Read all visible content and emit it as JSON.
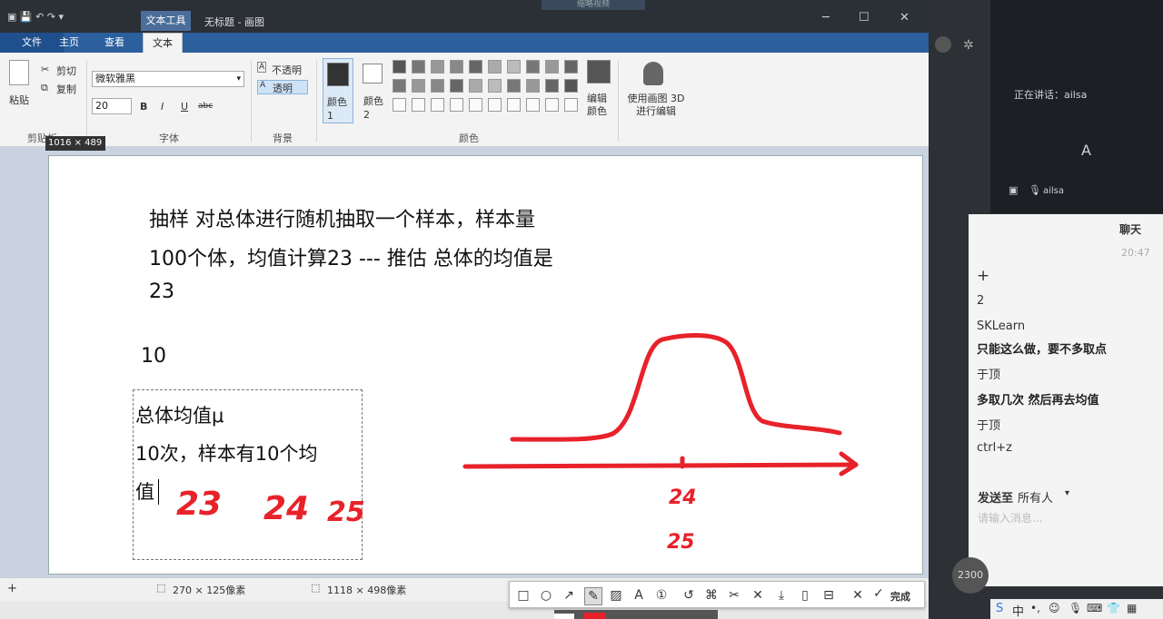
{
  "window": {
    "title": "无标题 - 画图",
    "context_tab": "文本工具",
    "top_hint": "缩略视频"
  },
  "tabs": [
    "文件",
    "主页",
    "查看",
    "文本"
  ],
  "ribbon": {
    "clipboard": {
      "paste": "粘贴",
      "cut": "剪切",
      "copy": "复制",
      "group": "剪贴板"
    },
    "font": {
      "family": "微软雅黑",
      "size": "20",
      "bold": "B",
      "italic": "I",
      "underline": "U",
      "strike": "abc",
      "group": "字体"
    },
    "background": {
      "opaque": "不透明",
      "transparent": "透明",
      "group": "背景"
    },
    "colors": {
      "color1": "颜色 1",
      "color2": "颜色 2",
      "edit_colors": "编辑颜色",
      "group": "颜色",
      "color1_value": "#333333",
      "color2_value": "#ffffff"
    },
    "paint3d": "使用画图 3D 进行编辑"
  },
  "canvas": {
    "size_tooltip": "1016 × 489",
    "lines": [
      "抽样  对总体进行随机抽取一个样本，样本量",
      "100个体，均值计算23 --- 推估 总体的均值是",
      "23"
    ],
    "number": "10",
    "textbox_lines": [
      "总体均值μ",
      "10次，样本有10个均",
      "值"
    ],
    "handwriting": [
      "23",
      "24",
      "25",
      "24",
      "25"
    ],
    "ink_color": "#e8222a"
  },
  "statusbar": {
    "selection": "270 × 125像素",
    "image_size": "1118 × 498像素"
  },
  "meeting": {
    "speaking": "正在讲话：ailsa",
    "avatar_letter": "A",
    "participant": "ailsa",
    "chat_title": "聊天",
    "chat_time": "20:47",
    "messages": [
      {
        "text": "+",
        "bold": false
      },
      {
        "text": "2",
        "bold": false
      },
      {
        "text": "SKLearn",
        "bold": false
      },
      {
        "text": "只能这么做，要不多取点",
        "bold": true
      },
      {
        "text": "于顶",
        "bold": false
      },
      {
        "text": "多取几次 然后再去均值",
        "bold": true
      },
      {
        "text": "于顶",
        "bold": false
      },
      {
        "text": "ctrl+z",
        "bold": false
      }
    ],
    "send_to_label": "发送至",
    "send_to_value": "所有人",
    "input_placeholder": "请输入消息...",
    "timer": "2300"
  },
  "annotation_toolbar": {
    "done": "完成"
  }
}
